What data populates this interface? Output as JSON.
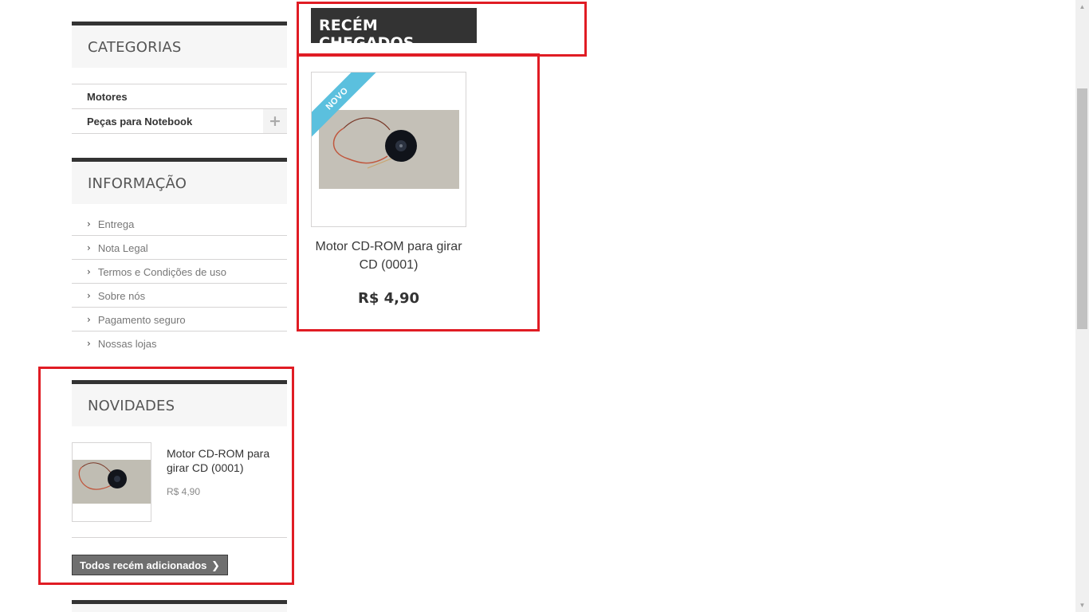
{
  "categories": {
    "title": "CATEGORIAS",
    "items": [
      {
        "label": "Motores",
        "has_children": false
      },
      {
        "label": "Peças para Notebook",
        "has_children": true,
        "toggle": "+"
      }
    ]
  },
  "information": {
    "title": "INFORMAÇÃO",
    "chevron": "›",
    "items": [
      {
        "label": "Entrega"
      },
      {
        "label": "Nota Legal"
      },
      {
        "label": "Termos e Condições de uso"
      },
      {
        "label": "Sobre nós"
      },
      {
        "label": "Pagamento seguro"
      },
      {
        "label": "Nossas lojas"
      }
    ]
  },
  "new_products": {
    "title": "NOVIDADES",
    "product": {
      "name": "Motor CD-ROM para girar CD (0001)",
      "price": "R$ 4,90",
      "image_icon": "cd-motor-image"
    },
    "all_button_label": "Todos recém adicionados",
    "all_button_icon": "chevron-right-icon"
  },
  "new_arrivals": {
    "title": "RECÉM CHEGADOS",
    "product": {
      "badge": "NOVO",
      "name": "Motor CD-ROM para girar CD (0001)",
      "price": "R$ 4,90",
      "image_icon": "cd-motor-image"
    }
  },
  "colors": {
    "dark": "#333333",
    "ribbon": "#5bc0de",
    "highlight": "#e01c24",
    "button": "#6f6f6f"
  }
}
